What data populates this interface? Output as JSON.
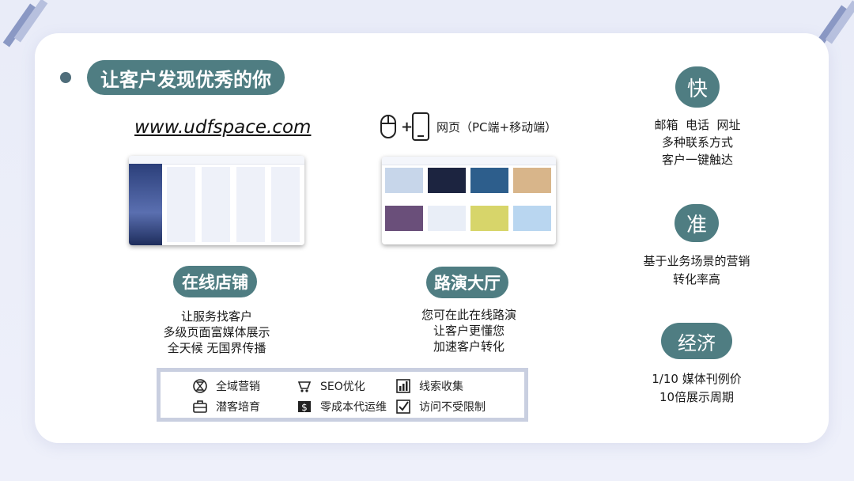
{
  "header": {
    "title": "让客户发现优秀的你"
  },
  "store": {
    "url": "www.udfspace.com",
    "label": "在线店铺",
    "lines": [
      "让服务找客户",
      "多级页面富媒体展示",
      "全天候 无国界传播"
    ]
  },
  "hall": {
    "device_text": "网页（PC端+移动端）",
    "label": "路演大厅",
    "lines": [
      "您可在此在线路演",
      "让客户更懂您",
      "加速客户转化"
    ]
  },
  "features": [
    {
      "icon": "hourglass-icon",
      "label": "全域营销"
    },
    {
      "icon": "cart-icon",
      "label": "SEO优化"
    },
    {
      "icon": "chart-icon",
      "label": "线索收集"
    },
    {
      "icon": "briefcase-icon",
      "label": "潜客培育"
    },
    {
      "icon": "money-icon",
      "label": "零成本代运维"
    },
    {
      "icon": "checkbox-icon",
      "label": "访问不受限制"
    }
  ],
  "benefits": [
    {
      "char": "快",
      "lines": [
        "邮箱  电话  网址",
        "多种联系方式",
        "客户一键触达"
      ]
    },
    {
      "char": "准",
      "lines": [
        "基于业务场景的营销",
        "转化率高"
      ]
    },
    {
      "char": "经济",
      "lines": [
        "1/10 媒体刊例价",
        "10倍展示周期"
      ]
    }
  ],
  "colors": {
    "accent": "#4f7d82",
    "stripe": "#8a98c4",
    "card": "#ffffff"
  }
}
